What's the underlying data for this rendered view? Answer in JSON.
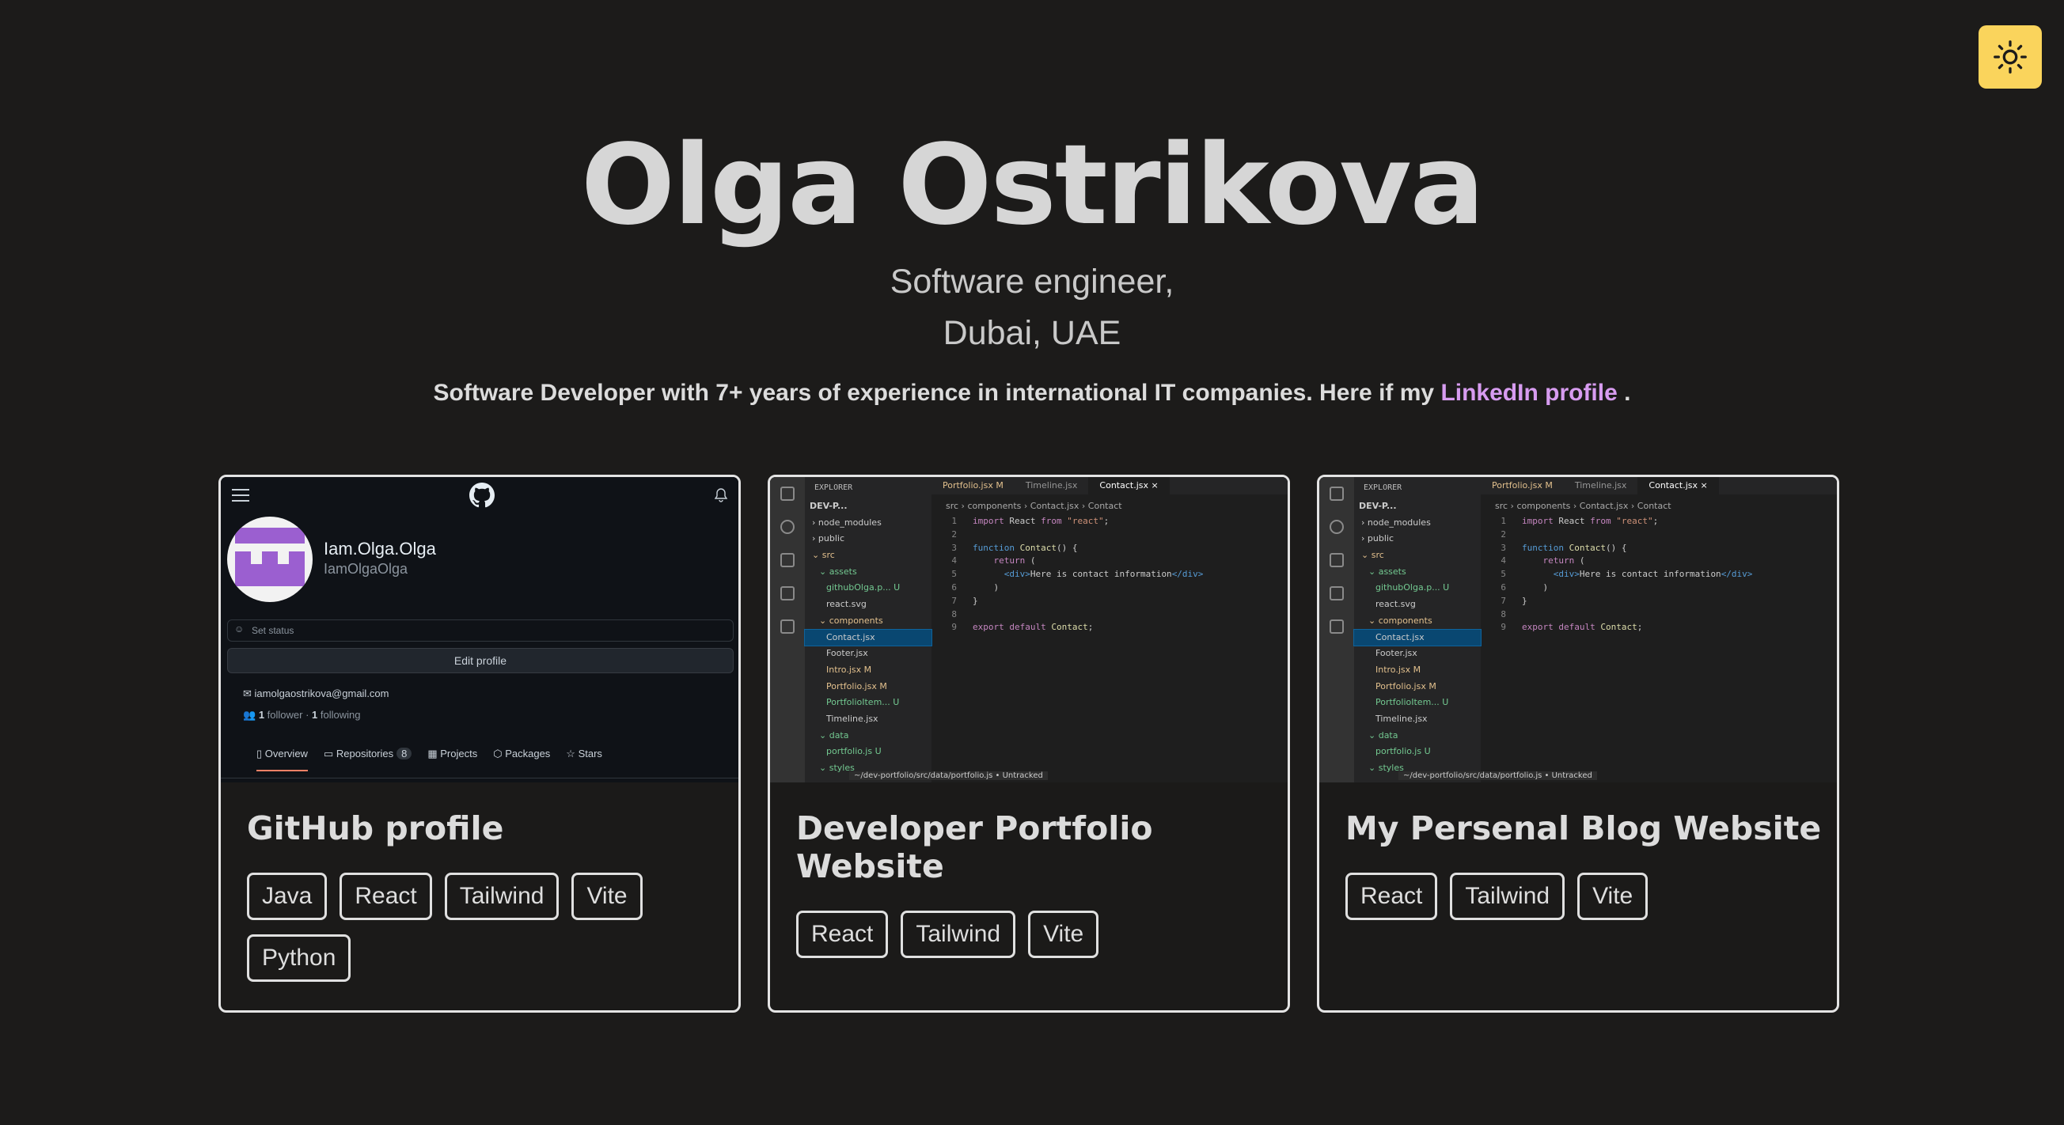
{
  "hero": {
    "name": "Olga Ostrikova",
    "role": "Software engineer,",
    "location": "Dubai, UAE",
    "bio_text": "Software Developer with 7+ years of experience in international IT companies. Here if my ",
    "bio_link": "LinkedIn profile",
    "bio_end": " ."
  },
  "theme_toggle": {
    "icon": "sun-icon",
    "color": "#fad45c"
  },
  "accent_link_color": "#d79cf0",
  "cards": [
    {
      "title": "GitHub profile",
      "tags": [
        "Java",
        "React",
        "Tailwind",
        "Vite",
        "Python"
      ],
      "github": {
        "display_name": "Iam.Olga.Olga",
        "login": "IamOlgaOlga",
        "status_placeholder": "Set status",
        "edit_button": "Edit profile",
        "email": "iamolgaostrikova@gmail.com",
        "followers_count": "1",
        "followers_label": "follower",
        "following_count": "1",
        "following_label": "following",
        "tabs": [
          "Overview",
          "Repositories",
          "Projects",
          "Packages",
          "Stars"
        ],
        "repo_count": "8"
      }
    },
    {
      "title": "Developer Portfolio Website",
      "tags": [
        "React",
        "Tailwind",
        "Vite"
      ]
    },
    {
      "title": "My Persenal Blog Website",
      "tags": [
        "React",
        "Tailwind",
        "Vite"
      ]
    }
  ],
  "vscode": {
    "explorer": "EXPLORER",
    "project": "DEV-P...",
    "tabs": [
      {
        "label": "Portfolio.jsx M",
        "state": "modified"
      },
      {
        "label": "Timeline.jsx",
        "state": "normal"
      },
      {
        "label": "Contact.jsx ×",
        "state": "active"
      }
    ],
    "breadcrumb": "src › components › Contact.jsx › Contact",
    "tree": [
      {
        "label": "› node_modules",
        "indent": 1,
        "kind": "folder"
      },
      {
        "label": "› public",
        "indent": 1,
        "kind": "folder"
      },
      {
        "label": "⌄ src",
        "indent": 1,
        "kind": "src"
      },
      {
        "label": "⌄ assets",
        "indent": 2,
        "kind": "unt"
      },
      {
        "label": "githubOlga.p...  U",
        "indent": 3,
        "kind": "unt"
      },
      {
        "label": "react.svg",
        "indent": 3,
        "kind": "folder"
      },
      {
        "label": "⌄ components",
        "indent": 2,
        "kind": "mod"
      },
      {
        "label": "Contact.jsx",
        "indent": 3,
        "kind": "sel"
      },
      {
        "label": "Footer.jsx",
        "indent": 3,
        "kind": "folder"
      },
      {
        "label": "Intro.jsx        M",
        "indent": 3,
        "kind": "mod"
      },
      {
        "label": "Portfolio.jsx   M",
        "indent": 3,
        "kind": "mod"
      },
      {
        "label": "PortfolioItem...  U",
        "indent": 3,
        "kind": "unt"
      },
      {
        "label": "Timeline.jsx",
        "indent": 3,
        "kind": "folder"
      },
      {
        "label": "⌄ data",
        "indent": 2,
        "kind": "unt"
      },
      {
        "label": "portfolio.js     U",
        "indent": 3,
        "kind": "unt"
      },
      {
        "label": "⌄ styles",
        "indent": 2,
        "kind": "unt"
      }
    ],
    "code": [
      {
        "n": "1",
        "html": "<span class=\"kw\">import</span> React <span class=\"kw\">from</span> <span class=\"str\">\"react\"</span>;"
      },
      {
        "n": "2",
        "html": ""
      },
      {
        "n": "3",
        "html": "<span class=\"tg\">function</span> <span class=\"fn\">Contact</span>() {"
      },
      {
        "n": "4",
        "html": "    <span class=\"kw\">return</span> ("
      },
      {
        "n": "5",
        "html": "      <span class=\"tg\">&lt;div&gt;</span>Here is contact information<span class=\"tg\">&lt;/div&gt;</span>"
      },
      {
        "n": "6",
        "html": "    )"
      },
      {
        "n": "7",
        "html": "}"
      },
      {
        "n": "8",
        "html": ""
      },
      {
        "n": "9",
        "html": "<span class=\"kw\">export default</span> <span class=\"fn\">Contact</span>;"
      }
    ],
    "status_path": "~/dev-portfolio/src/data/portfolio.js • Untracked"
  }
}
